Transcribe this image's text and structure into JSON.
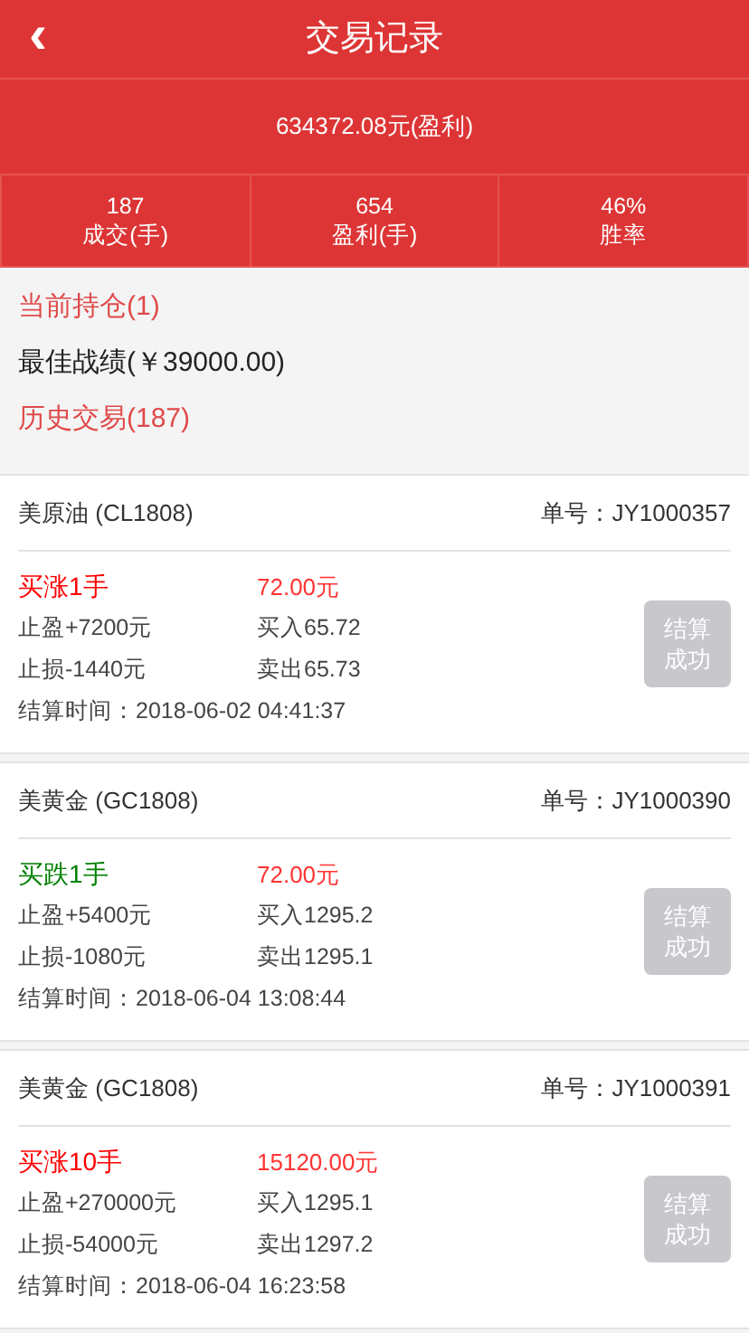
{
  "header": {
    "back": "‹",
    "title": "交易记录"
  },
  "profit": "634372.08元(盈利)",
  "stats": [
    {
      "value": "187",
      "label": "成交(手)"
    },
    {
      "value": "654",
      "label": "盈利(手)"
    },
    {
      "value": "46%",
      "label": "胜率"
    }
  ],
  "summary": [
    {
      "kind": "link",
      "text": "当前持仓(1)"
    },
    {
      "kind": "plain",
      "text": "最佳战绩(￥39000.00)"
    },
    {
      "kind": "link",
      "text": "历史交易(187)"
    }
  ],
  "trades": [
    {
      "name": "美原油 (CL1808)",
      "order": "单号：JY1000357",
      "color": "#ff0000",
      "action": "买涨1手",
      "amount": "72.00元",
      "take_profit": "止盈+7200元",
      "stop_loss": "止损-1440元",
      "buy": "买入65.72",
      "sell": "卖出65.73",
      "time": "结算时间：2018-06-02 04:41:37",
      "status": "结算成功",
      "disabled": true
    },
    {
      "name": "美黄金 (GC1808)",
      "order": "单号：JY1000390",
      "color": "#008000",
      "action": "买跌1手",
      "amount": "72.00元",
      "take_profit": "止盈+5400元",
      "stop_loss": "止损-1080元",
      "buy": "买入1295.2",
      "sell": "卖出1295.1",
      "time": "结算时间：2018-06-04 13:08:44",
      "status": "结算成功",
      "disabled": true
    },
    {
      "name": "美黄金 (GC1808)",
      "order": "单号：JY1000391",
      "color": "#ff0000",
      "action": "买涨10手",
      "amount": "15120.00元",
      "take_profit": "止盈+270000元",
      "stop_loss": "止损-54000元",
      "buy": "买入1295.1",
      "sell": "卖出1297.2",
      "time": "结算时间：2018-06-04 16:23:58",
      "status": "结算成功",
      "disabled": true
    }
  ]
}
